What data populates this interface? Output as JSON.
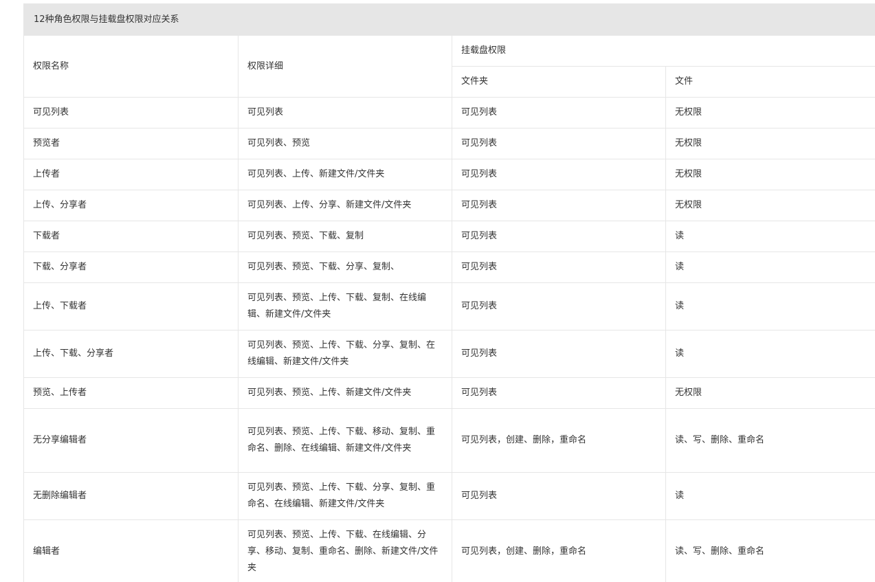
{
  "table": {
    "caption": "12种角色权限与挂载盘权限对应关系",
    "headers": {
      "name": "权限名称",
      "detail": "权限详细",
      "mount": "挂载盘权限",
      "folder": "文件夹",
      "file": "文件"
    },
    "rows": [
      {
        "name": "可见列表",
        "detail": "可见列表",
        "folder": "可见列表",
        "file": "无权限"
      },
      {
        "name": "预览者",
        "detail": "可见列表、预览",
        "folder": "可见列表",
        "file": "无权限"
      },
      {
        "name": "上传者",
        "detail": "可见列表、上传、新建文件/文件夹",
        "folder": "可见列表",
        "file": "无权限"
      },
      {
        "name": "上传、分享者",
        "detail": "可见列表、上传、分享、新建文件/文件夹",
        "folder": "可见列表",
        "file": "无权限"
      },
      {
        "name": "下载者",
        "detail": "可见列表、预览、下载、复制",
        "folder": "可见列表",
        "file": "读"
      },
      {
        "name": "下载、分享者",
        "detail": "可见列表、预览、下载、分享、复制、",
        "folder": "可见列表",
        "file": "读"
      },
      {
        "name": "上传、下载者",
        "detail": "可见列表、预览、上传、下载、复制、在线编辑、新建文件/文件夹",
        "folder": "可见列表",
        "file": "读"
      },
      {
        "name": "上传、下载、分享者",
        "detail": "可见列表、预览、上传、下载、分享、复制、在线编辑、新建文件/文件夹",
        "folder": "可见列表",
        "file": "读"
      },
      {
        "name": "预览、上传者",
        "detail": "可见列表、预览、上传、新建文件/文件夹",
        "folder": "可见列表",
        "file": "无权限"
      },
      {
        "name": "无分享编辑者",
        "detail": "可见列表、预览、上传、下载、移动、复制、重命名、删除、在线编辑、新建文件/文件夹",
        "folder": "可见列表，创建、删除，重命名",
        "file": "读、写、删除、重命名"
      },
      {
        "name": "无删除编辑者",
        "detail": "可见列表、预览、上传、下载、分享、复制、重命名、在线编辑、新建文件/文件夹",
        "folder": "可见列表",
        "file": "读"
      },
      {
        "name": "编辑者",
        "detail": "可见列表、预览、上传、下载、在线编辑、分享、移动、复制、重命名、删除、新建文件/文件夹",
        "folder": "可见列表，创建、删除，重命名",
        "file": "读、写、删除、重命名"
      }
    ]
  }
}
